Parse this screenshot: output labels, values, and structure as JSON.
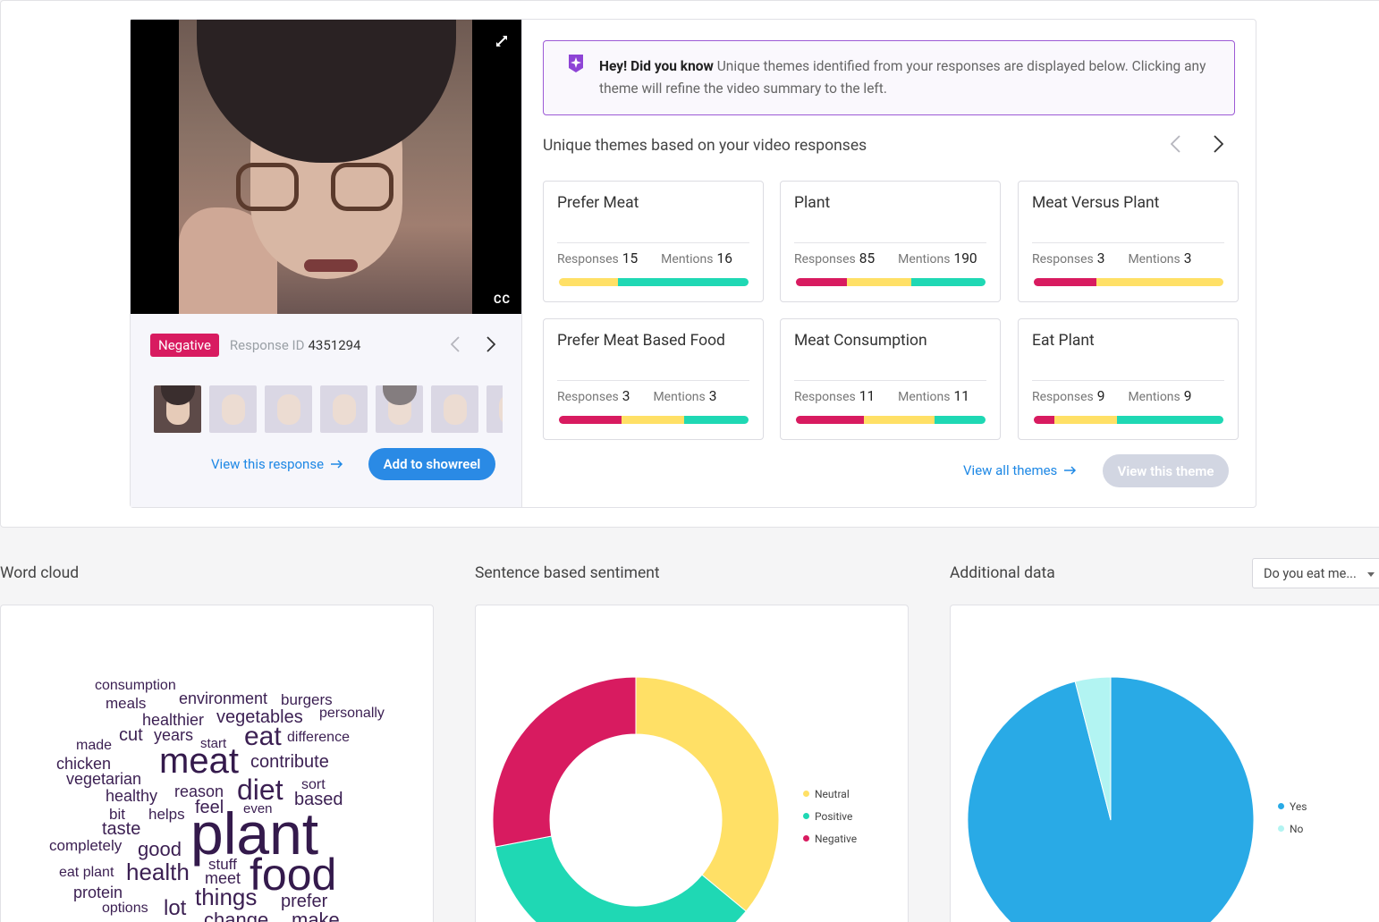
{
  "response": {
    "sentiment_badge": "Negative",
    "id_label": "Response ID",
    "id_value": "4351294",
    "cc": "CC",
    "view_label": "View this response",
    "showreel_label": "Add to showreel"
  },
  "tip": {
    "bold": "Hey! Did you know",
    "text": " Unique themes identified from your responses are displayed below. Clicking any theme will refine the video summary to the left."
  },
  "themes": {
    "title": "Unique themes based on your video responses",
    "responses_label": "Responses",
    "mentions_label": "Mentions",
    "view_all_label": "View all themes",
    "view_theme_label": "View this theme",
    "items": [
      {
        "name": "Prefer Meat",
        "responses": "15",
        "mentions": "16",
        "bar": [
          0,
          0.31,
          0.69
        ]
      },
      {
        "name": "Plant",
        "responses": "85",
        "mentions": "190",
        "bar": [
          0.27,
          0.34,
          0.39
        ]
      },
      {
        "name": "Meat Versus Plant",
        "responses": "3",
        "mentions": "3",
        "bar": [
          0.33,
          0.67,
          0
        ]
      },
      {
        "name": "Prefer Meat Based Food",
        "responses": "3",
        "mentions": "3",
        "bar": [
          0.33,
          0.33,
          0.34
        ]
      },
      {
        "name": "Meat Consumption",
        "responses": "11",
        "mentions": "11",
        "bar": [
          0.36,
          0.37,
          0.27
        ]
      },
      {
        "name": "Eat Plant",
        "responses": "9",
        "mentions": "9",
        "bar": [
          0.11,
          0.33,
          0.56
        ]
      }
    ]
  },
  "sections": {
    "word_cloud": "Word cloud",
    "sentiment": "Sentence based sentiment",
    "additional": "Additional data",
    "dropdown_value": "Do you eat me..."
  },
  "word_cloud": [
    {
      "w": "consumption",
      "s": 16
    },
    {
      "w": "meals",
      "s": 17
    },
    {
      "w": "environment",
      "s": 18
    },
    {
      "w": "burgers",
      "s": 17
    },
    {
      "w": "healthier",
      "s": 18
    },
    {
      "w": "vegetables",
      "s": 20
    },
    {
      "w": "personally",
      "s": 16
    },
    {
      "w": "made",
      "s": 16
    },
    {
      "w": "cut",
      "s": 20
    },
    {
      "w": "years",
      "s": 18
    },
    {
      "w": "start",
      "s": 15
    },
    {
      "w": "eat",
      "s": 30
    },
    {
      "w": "difference",
      "s": 16
    },
    {
      "w": "chicken",
      "s": 18
    },
    {
      "w": "meat",
      "s": 40
    },
    {
      "w": "contribute",
      "s": 20
    },
    {
      "w": "vegetarian",
      "s": 18
    },
    {
      "w": "healthy",
      "s": 18
    },
    {
      "w": "reason",
      "s": 18
    },
    {
      "w": "diet",
      "s": 32
    },
    {
      "w": "sort",
      "s": 16
    },
    {
      "w": "based",
      "s": 20
    },
    {
      "w": "bit",
      "s": 17
    },
    {
      "w": "helps",
      "s": 17
    },
    {
      "w": "feel",
      "s": 20
    },
    {
      "w": "even",
      "s": 15
    },
    {
      "w": "taste",
      "s": 20
    },
    {
      "w": "plant",
      "s": 66
    },
    {
      "w": "completely",
      "s": 17
    },
    {
      "w": "good",
      "s": 22
    },
    {
      "w": "stuff",
      "s": 17
    },
    {
      "w": "eat plant",
      "s": 16
    },
    {
      "w": "health",
      "s": 26
    },
    {
      "w": "meet",
      "s": 18
    },
    {
      "w": "food",
      "s": 50
    },
    {
      "w": "protein",
      "s": 18
    },
    {
      "w": "things",
      "s": 26
    },
    {
      "w": "prefer",
      "s": 20
    },
    {
      "w": "options",
      "s": 16
    },
    {
      "w": "lot",
      "s": 24
    },
    {
      "w": "change",
      "s": 22
    },
    {
      "w": "make",
      "s": 22
    }
  ],
  "chart_data": [
    {
      "type": "pie",
      "title": "Sentence based sentiment",
      "categories": [
        "Neutral",
        "Positive",
        "Negative"
      ],
      "values": [
        36,
        36,
        28
      ],
      "colors": [
        "#ffe066",
        "#1fd8b4",
        "#d81b60"
      ],
      "donut": true,
      "legend": "right"
    },
    {
      "type": "pie",
      "title": "Additional data",
      "categories": [
        "Yes",
        "No"
      ],
      "values": [
        96,
        4
      ],
      "colors": [
        "#29aae6",
        "#b2f4f2"
      ],
      "donut": false,
      "legend": "right"
    }
  ]
}
